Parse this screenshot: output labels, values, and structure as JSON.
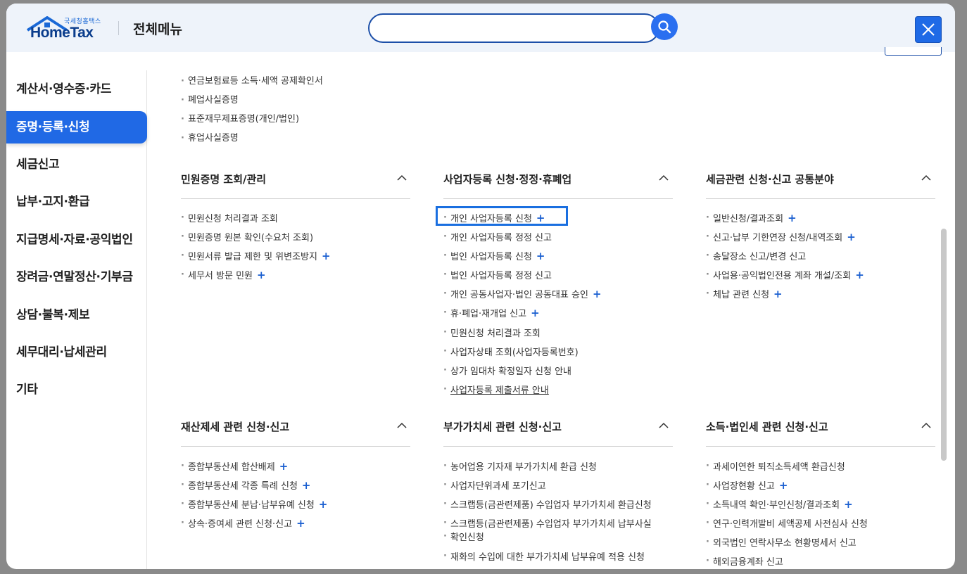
{
  "header": {
    "logo_small": "국세청홈택스",
    "logo_big": "HomeTax",
    "title": "전체메뉴",
    "search_value": ""
  },
  "sidebar": {
    "items": [
      {
        "label": "계산서·영수증·카드"
      },
      {
        "label": "증명·등록·신청",
        "active": true
      },
      {
        "label": "세금신고"
      },
      {
        "label": "납부·고지·환급"
      },
      {
        "label": "지급명세·자료·공익법인"
      },
      {
        "label": "장려금·연말정산·기부금"
      },
      {
        "label": "상담·불복·제보"
      },
      {
        "label": "세무대리·납세관리"
      },
      {
        "label": "기타"
      }
    ]
  },
  "top_list": [
    "연금보험료등 소득·세액 공제확인서",
    "폐업사실증명",
    "표준재무제표증명(개인/법인)",
    "휴업사실증명"
  ],
  "sections": [
    {
      "title": "민원증명 조회/관리",
      "items": [
        {
          "label": "민원신청 처리결과 조회",
          "plus": ""
        },
        {
          "label": "민원증명 원본 확인(수요처 조회)",
          "plus": ""
        },
        {
          "label": "민원서류 발급 제한 및 위변조방지",
          "plus": "+"
        },
        {
          "label": "세무서 방문 민원",
          "plus": "+"
        }
      ]
    },
    {
      "title": "사업자등록 신청·정정·휴폐업",
      "items": [
        {
          "label": "개인 사업자등록 신청",
          "plus": "+"
        },
        {
          "label": "개인 사업자등록 정정 신고",
          "plus": ""
        },
        {
          "label": "법인 사업자등록 신청",
          "plus": "+"
        },
        {
          "label": "법인 사업자등록 정정 신고",
          "plus": ""
        },
        {
          "label": "개인 공동사업자·법인 공동대표 승인",
          "plus": "+"
        },
        {
          "label": "휴·폐업·재개업 신고",
          "plus": "+"
        },
        {
          "label": "민원신청 처리결과 조회",
          "plus": ""
        },
        {
          "label": "사업자상태 조회(사업자등록번호)",
          "plus": ""
        },
        {
          "label": "상가 임대차 확정일자 신청 안내",
          "plus": ""
        },
        {
          "label": "사업자등록 제출서류 안내",
          "plus": ""
        }
      ]
    },
    {
      "title": "세금관련 신청·신고 공통분야",
      "items": [
        {
          "label": "일반신청/결과조회",
          "plus": "+"
        },
        {
          "label": "신고·납부 기한연장 신청/내역조회",
          "plus": "+"
        },
        {
          "label": "송달장소 신고/변경 신고",
          "plus": ""
        },
        {
          "label": "사업용·공익법인전용 계좌 개설/조회",
          "plus": "+"
        },
        {
          "label": "체납 관련 신청",
          "plus": "+"
        }
      ]
    },
    {
      "title": "재산제세 관련 신청·신고",
      "items": [
        {
          "label": "종합부동산세 합산배제",
          "plus": "+"
        },
        {
          "label": "종합부동산세 각종 특례 신청",
          "plus": "+"
        },
        {
          "label": "종합부동산세 분납·납부유예 신청",
          "plus": "+"
        },
        {
          "label": "상속·증여세 관련 신청·신고",
          "plus": "+"
        }
      ]
    },
    {
      "title": "부가가치세 관련 신청·신고",
      "items": [
        {
          "label": "농어업용 기자재 부가가치세 환급 신청",
          "plus": ""
        },
        {
          "label": "사업자단위과세 포기신고",
          "plus": ""
        },
        {
          "label": "스크랩등(금관련제품) 수입업자 부가가치세 환급신청",
          "plus": ""
        },
        {
          "label": "스크랩등(금관련제품) 수입업자 부가가치세 납부사실",
          "plus": ""
        },
        {
          "label": "확인신청",
          "plus": ""
        },
        {
          "label": "재화의 수입에 대한 부가가치세 납부유예 적용 신청",
          "plus": ""
        }
      ]
    },
    {
      "title": "소득·법인세 관련 신청·신고",
      "items": [
        {
          "label": "과세이연한 퇴직소득세액 환급신청",
          "plus": ""
        },
        {
          "label": "사업장현황 신고",
          "plus": "+"
        },
        {
          "label": "소득내역 확인·부인신청/결과조회",
          "plus": "+"
        },
        {
          "label": "연구·인력개발비 세액공제 사전심사 신청",
          "plus": ""
        },
        {
          "label": "외국법인 연락사무소 현황명세서 신고",
          "plus": ""
        },
        {
          "label": "해외금융계좌 신고",
          "plus": ""
        }
      ]
    }
  ]
}
